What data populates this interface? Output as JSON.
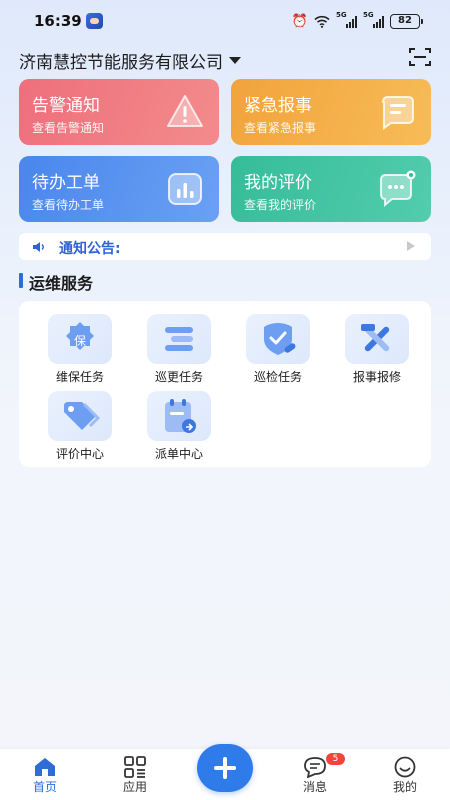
{
  "status_bar": {
    "time": "16:39",
    "network_5g_label_1": "5G",
    "network_5g_label_2": "5G",
    "battery": "82"
  },
  "header": {
    "company": "济南慧控节能服务有限公司",
    "scan_icon": "scan-icon"
  },
  "cards": [
    {
      "title": "告警通知",
      "subtitle": "查看告警通知",
      "color": "#ee6f7c",
      "icon": "alert-icon"
    },
    {
      "title": "紧急报事",
      "subtitle": "查看紧急报事",
      "color": "#f2a33c",
      "icon": "report-icon"
    },
    {
      "title": "待办工单",
      "subtitle": "查看待办工单",
      "color": "#4a86ec",
      "icon": "chart-icon"
    },
    {
      "title": "我的评价",
      "subtitle": "查看我的评价",
      "color": "#36bc9a",
      "icon": "chat-icon"
    }
  ],
  "notice": {
    "label": "通知公告:"
  },
  "section": {
    "title": "运维服务"
  },
  "services": [
    {
      "label": "维保任务",
      "icon_text": "保",
      "icon": "maintenance-icon"
    },
    {
      "label": "巡更任务",
      "icon": "patrol-icon"
    },
    {
      "label": "巡检任务",
      "icon": "inspection-icon"
    },
    {
      "label": "报事报修",
      "icon": "repair-icon"
    },
    {
      "label": "评价中心",
      "icon": "tag-icon"
    },
    {
      "label": "派单中心",
      "icon": "dispatch-icon"
    }
  ],
  "bottom_nav": {
    "items": [
      {
        "label": "首页",
        "active": true,
        "icon": "home-icon"
      },
      {
        "label": "应用",
        "active": false,
        "icon": "apps-icon"
      },
      {
        "label": "消息",
        "active": false,
        "icon": "message-icon"
      },
      {
        "label": "我的",
        "active": false,
        "icon": "profile-icon"
      }
    ],
    "message_badge": "5"
  },
  "colors": {
    "accent": "#2f6cd8",
    "fab": "#2f7bea",
    "badge": "#f0443c"
  }
}
